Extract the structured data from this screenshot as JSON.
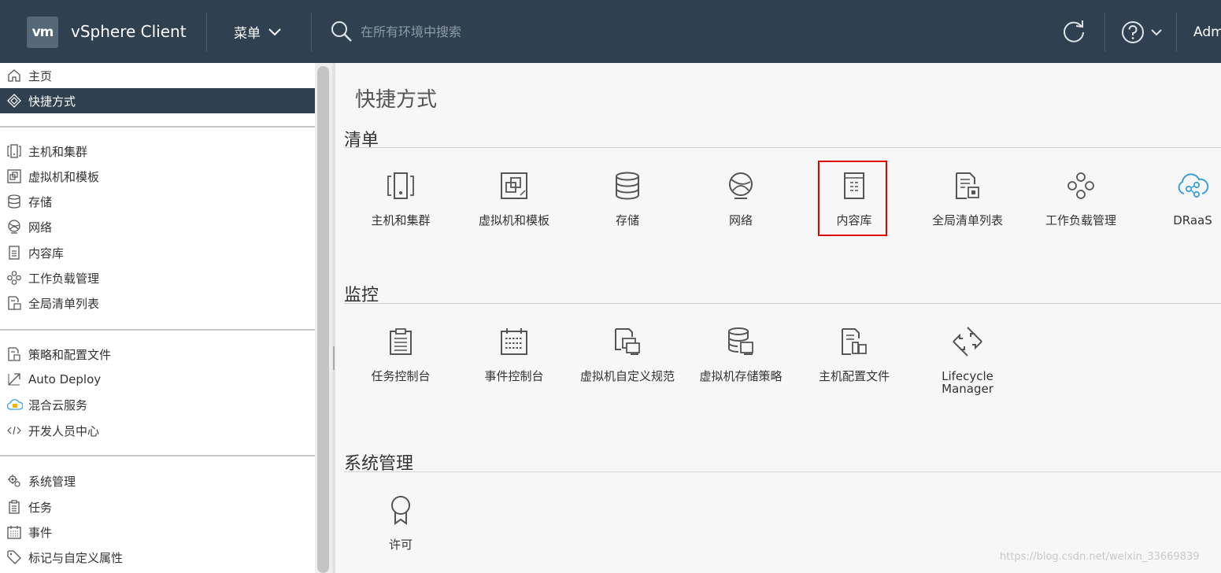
{
  "header": {
    "logo_text": "vm",
    "app_title": "vSphere Client",
    "menu_label": "菜单",
    "search_placeholder": "在所有环境中搜索",
    "user_label": "Adm"
  },
  "sidebar": {
    "items": [
      {
        "label": "主页",
        "icon": "home-icon"
      },
      {
        "label": "快捷方式",
        "icon": "shortcuts-icon",
        "active": true
      },
      {
        "label": "主机和集群",
        "icon": "hosts-clusters-icon"
      },
      {
        "label": "虚拟机和模板",
        "icon": "vms-templates-icon"
      },
      {
        "label": "存储",
        "icon": "storage-icon"
      },
      {
        "label": "网络",
        "icon": "network-icon"
      },
      {
        "label": "内容库",
        "icon": "content-library-icon"
      },
      {
        "label": "工作负载管理",
        "icon": "workload-management-icon"
      },
      {
        "label": "全局清单列表",
        "icon": "global-inventory-icon"
      },
      {
        "label": "策略和配置文件",
        "icon": "policies-profiles-icon"
      },
      {
        "label": "Auto Deploy",
        "icon": "auto-deploy-icon"
      },
      {
        "label": "混合云服务",
        "icon": "hybrid-cloud-icon"
      },
      {
        "label": "开发人员中心",
        "icon": "developer-center-icon"
      },
      {
        "label": "系统管理",
        "icon": "administration-icon"
      },
      {
        "label": "任务",
        "icon": "tasks-icon"
      },
      {
        "label": "事件",
        "icon": "events-icon"
      },
      {
        "label": "标记与自定义属性",
        "icon": "tags-icon"
      }
    ]
  },
  "main": {
    "title": "快捷方式",
    "sections": [
      {
        "title": "清单",
        "tiles": [
          {
            "label": "主机和集群",
            "icon": "hosts-clusters-icon"
          },
          {
            "label": "虚拟机和模板",
            "icon": "vms-templates-icon"
          },
          {
            "label": "存储",
            "icon": "storage-icon"
          },
          {
            "label": "网络",
            "icon": "network-icon"
          },
          {
            "label": "内容库",
            "icon": "content-library-icon",
            "highlighted": true
          },
          {
            "label": "全局清单列表",
            "icon": "global-inventory-icon"
          },
          {
            "label": "工作负载管理",
            "icon": "workload-management-icon"
          },
          {
            "label": "DRaaS",
            "icon": "draas-icon"
          }
        ]
      },
      {
        "title": "监控",
        "tiles": [
          {
            "label": "任务控制台",
            "icon": "task-console-icon"
          },
          {
            "label": "事件控制台",
            "icon": "event-console-icon"
          },
          {
            "label": "虚拟机自定义规范",
            "icon": "vm-customization-icon"
          },
          {
            "label": "虚拟机存储策略",
            "icon": "vm-storage-policy-icon"
          },
          {
            "label": "主机配置文件",
            "icon": "host-profiles-icon"
          },
          {
            "label": "Lifecycle Manager",
            "icon": "lifecycle-manager-icon"
          }
        ]
      },
      {
        "title": "系统管理",
        "tiles": [
          {
            "label": "许可",
            "icon": "licensing-icon"
          }
        ]
      }
    ]
  },
  "watermark": "https://blog.csdn.net/weixin_33669839",
  "colors": {
    "header_bg": "#2f4051",
    "active_nav_bg": "#2f4051",
    "highlight_border": "#e00000",
    "draas_icon": "#3aa0d8"
  }
}
